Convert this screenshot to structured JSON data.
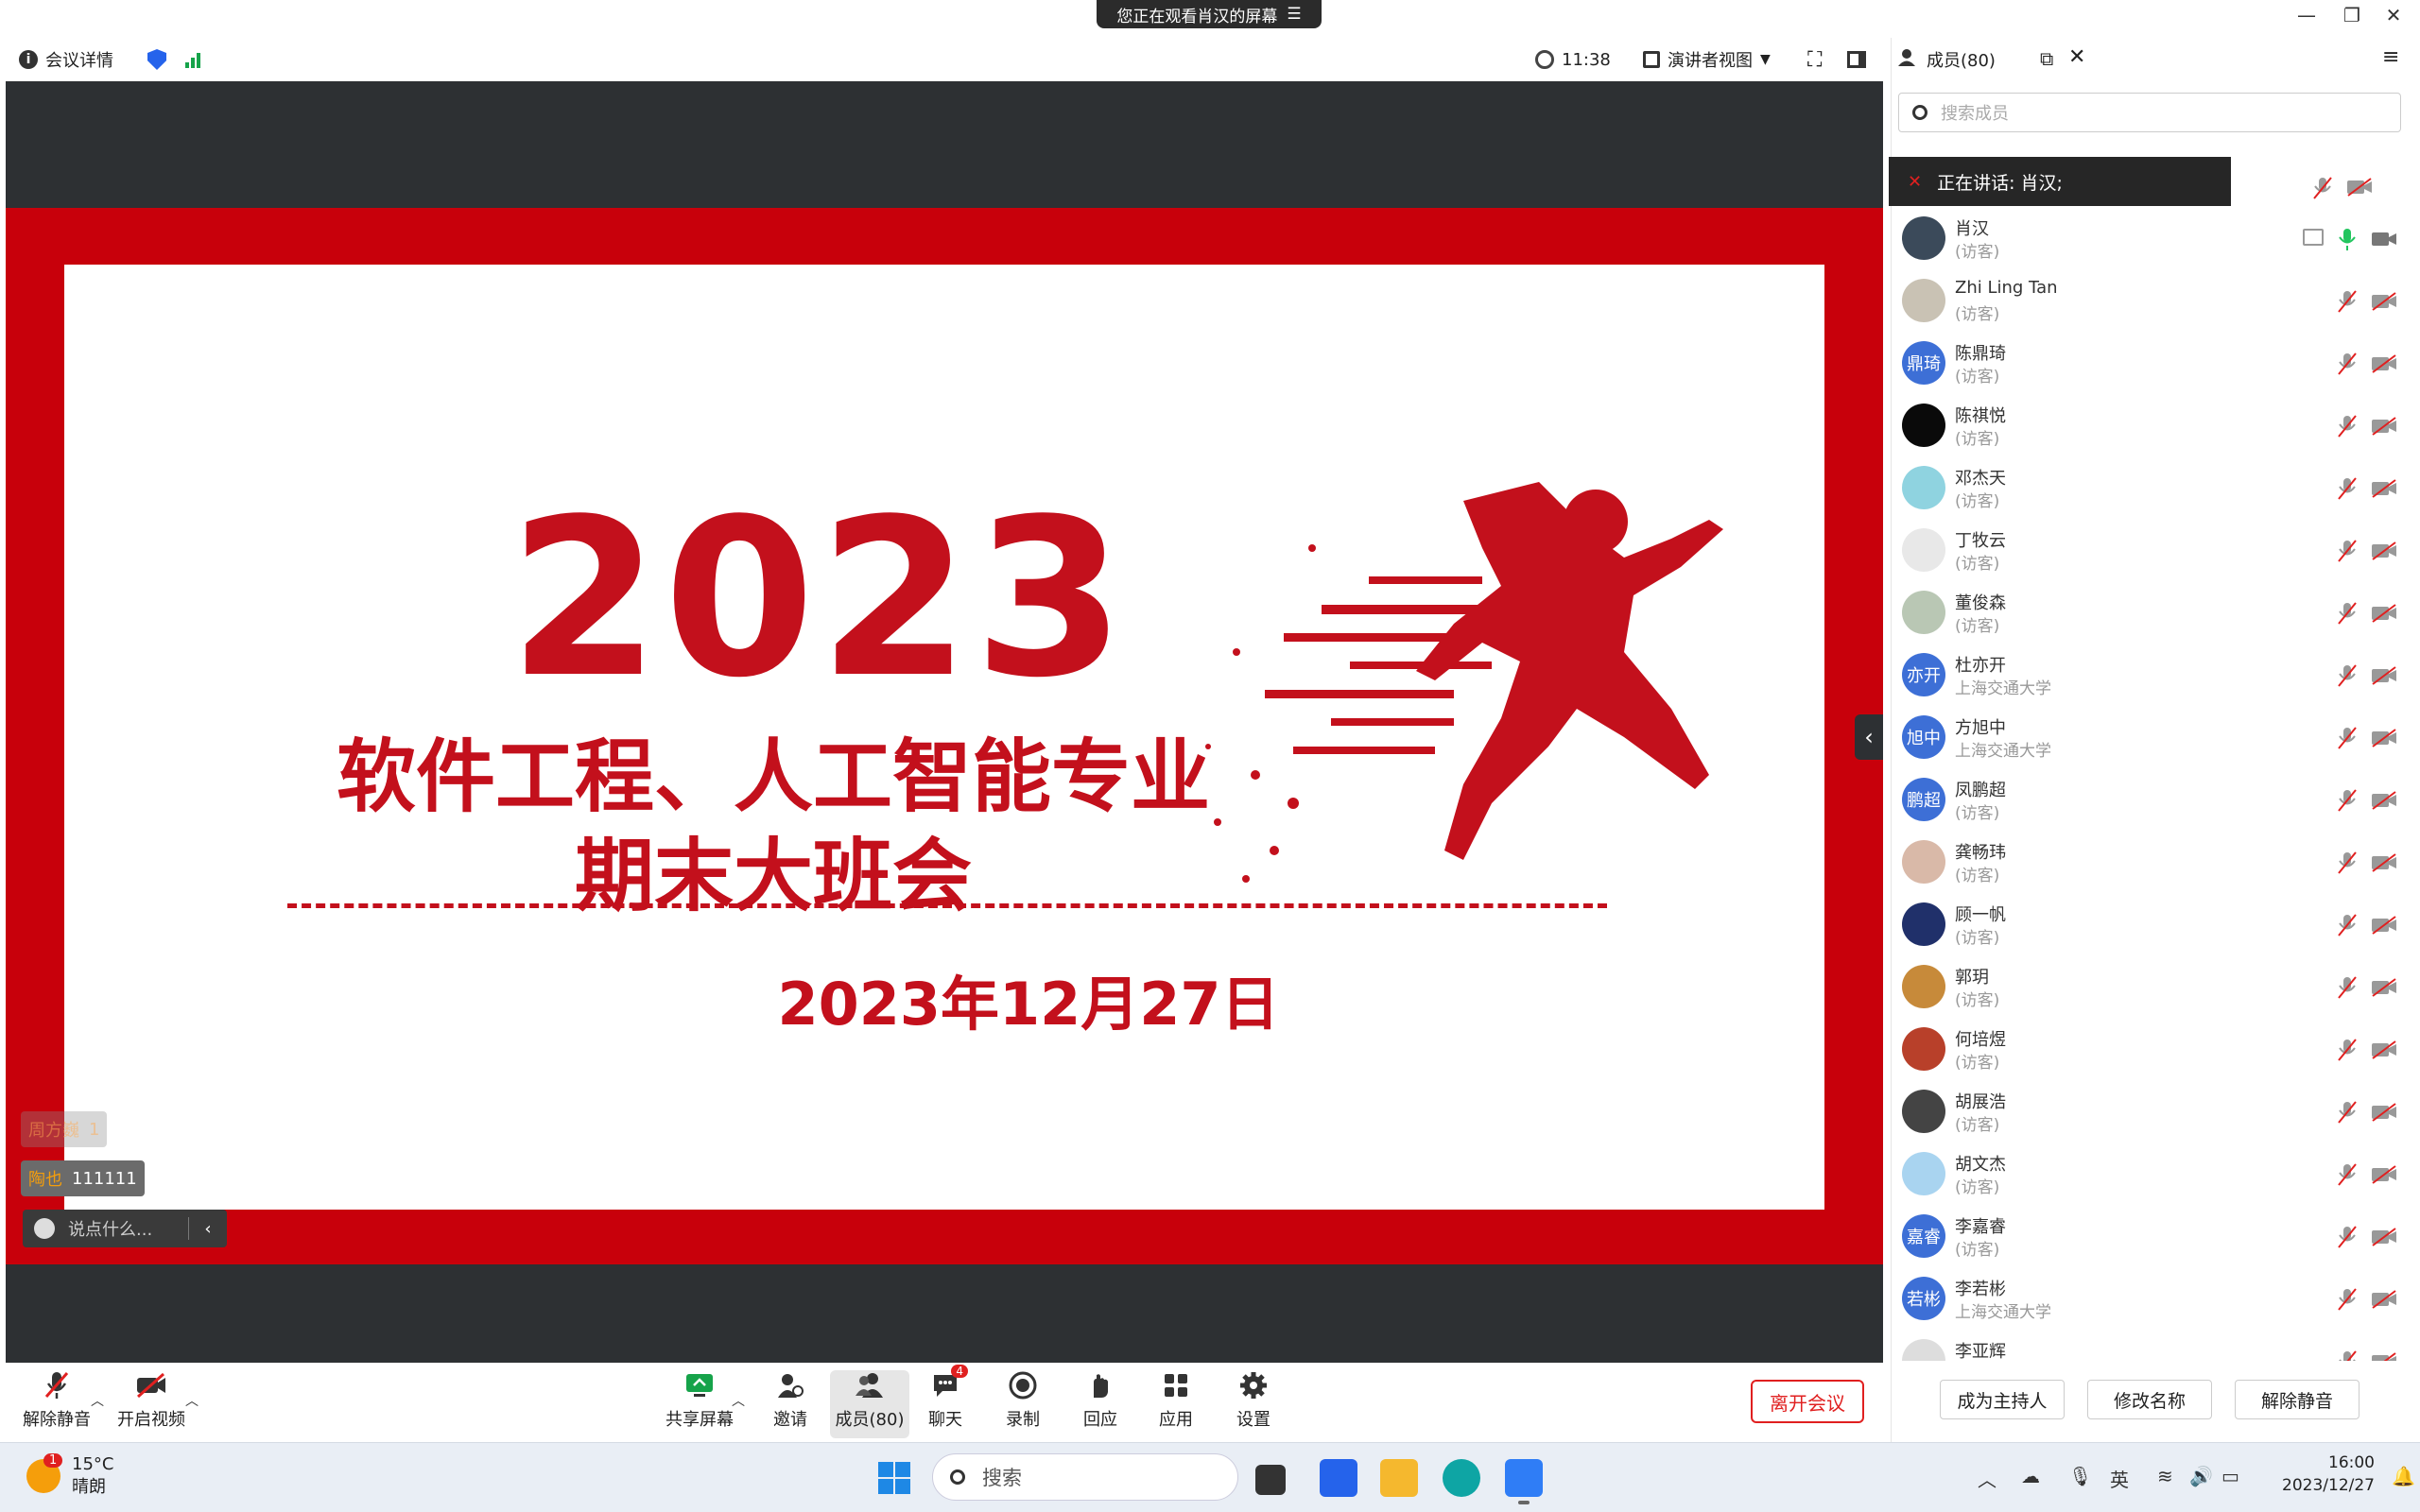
{
  "notice": {
    "text": "您正在观看肖汉的屏幕",
    "menu_icon": "menu-lines-icon"
  },
  "window_controls": [
    "minimize-icon",
    "restore-icon",
    "close-icon"
  ],
  "topbar": {
    "meeting_details": "会议详情",
    "time": "11:38",
    "view_mode": "演讲者视图"
  },
  "slide": {
    "year": "2023",
    "title_line1": "软件工程、人工智能专业",
    "title_line2": "期末大班会",
    "date": "2023年12月27日"
  },
  "danmaku": [
    {
      "name": "周方巍",
      "text": "1"
    },
    {
      "name": "陶也",
      "text": "111111"
    }
  ],
  "chat_placeholder": "说点什么...",
  "toolbar": {
    "unmute": "解除静音",
    "start_video": "开启视频",
    "share_screen": "共享屏幕",
    "invite": "邀请",
    "members": "成员(80)",
    "chat": "聊天",
    "chat_badge": "4",
    "record": "录制",
    "reactions": "回应",
    "apps": "应用",
    "settings": "设置",
    "leave": "离开会议"
  },
  "panel": {
    "title": "成员(80)",
    "search_placeholder": "搜索成员",
    "speaking_label": "正在讲话:",
    "speaking_name": "肖汉;",
    "buttons": {
      "make_host": "成为主持人",
      "rename": "修改名称",
      "unmute_all": "解除静音"
    }
  },
  "members": [
    {
      "name": "肖汉",
      "sub": "(访客)",
      "avatar_text": "",
      "avatar_color": "#3b4a5a",
      "mic_on": true,
      "sharing": true
    },
    {
      "name": "Zhi Ling Tan",
      "sub": "(访客)",
      "avatar_text": "",
      "avatar_color": "#c9c2b4"
    },
    {
      "name": "陈鼎琦",
      "sub": "(访客)",
      "avatar_text": "鼎琦",
      "avatar_color": "#3d6fd6"
    },
    {
      "name": "陈祺悦",
      "sub": "(访客)",
      "avatar_text": "",
      "avatar_color": "#0a0a0a"
    },
    {
      "name": "邓杰天",
      "sub": "(访客)",
      "avatar_text": "",
      "avatar_color": "#8fd3e0"
    },
    {
      "name": "丁牧云",
      "sub": "(访客)",
      "avatar_text": "",
      "avatar_color": "#e8e8e8"
    },
    {
      "name": "董俊森",
      "sub": "(访客)",
      "avatar_text": "",
      "avatar_color": "#b9c7b4"
    },
    {
      "name": "杜亦开",
      "sub": "上海交通大学",
      "avatar_text": "亦开",
      "avatar_color": "#3d6fd6"
    },
    {
      "name": "方旭中",
      "sub": "上海交通大学",
      "avatar_text": "旭中",
      "avatar_color": "#3d6fd6"
    },
    {
      "name": "凤鹏超",
      "sub": "(访客)",
      "avatar_text": "鹏超",
      "avatar_color": "#3d6fd6"
    },
    {
      "name": "龚畅玮",
      "sub": "(访客)",
      "avatar_text": "",
      "avatar_color": "#d9b9a8"
    },
    {
      "name": "顾一帆",
      "sub": "(访客)",
      "avatar_text": "",
      "avatar_color": "#20306a"
    },
    {
      "name": "郭玥",
      "sub": "(访客)",
      "avatar_text": "",
      "avatar_color": "#c78a3a"
    },
    {
      "name": "何培煜",
      "sub": "(访客)",
      "avatar_text": "",
      "avatar_color": "#b8402a"
    },
    {
      "name": "胡展浩",
      "sub": "(访客)",
      "avatar_text": "",
      "avatar_color": "#444444"
    },
    {
      "name": "胡文杰",
      "sub": "(访客)",
      "avatar_text": "",
      "avatar_color": "#a9d4f0"
    },
    {
      "name": "李嘉睿",
      "sub": "(访客)",
      "avatar_text": "嘉睿",
      "avatar_color": "#3d6fd6"
    },
    {
      "name": "李若彬",
      "sub": "上海交通大学",
      "avatar_text": "若彬",
      "avatar_color": "#3d6fd6"
    },
    {
      "name": "李亚辉",
      "sub": "",
      "avatar_text": "",
      "avatar_color": "#dddddd"
    }
  ],
  "taskbar": {
    "weather_temp": "15°C",
    "weather_desc": "晴朗",
    "weather_badge": "1",
    "search": "搜索",
    "ime": "英",
    "time": "16:00",
    "date": "2023/12/27"
  },
  "colors": {
    "slide_red": "#c8000b",
    "accent_blue": "#3d6fd6",
    "leave_red": "#e02020",
    "mic_green": "#22c55e"
  }
}
